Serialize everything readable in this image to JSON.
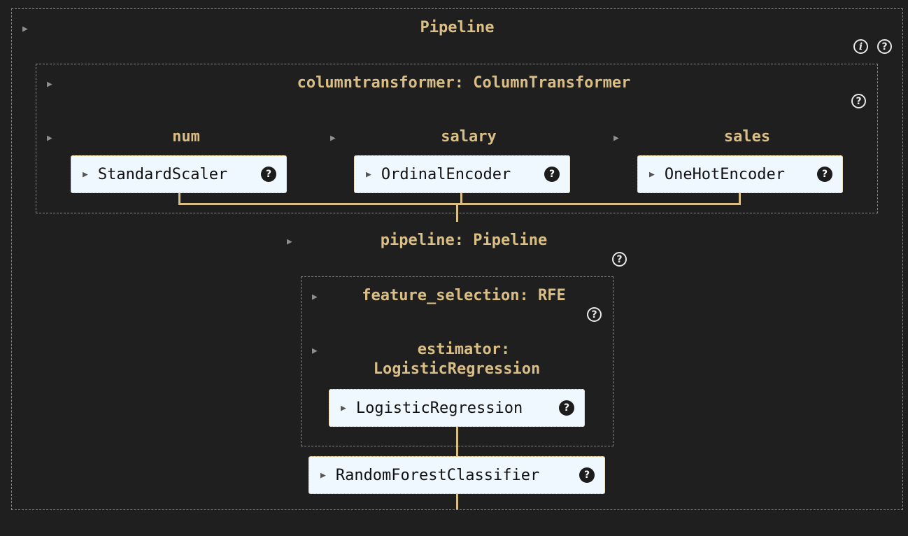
{
  "pipeline": {
    "title": "Pipeline",
    "info_icon_glyph": "i",
    "help_icon_glyph": "?"
  },
  "columntransformer": {
    "title": "columntransformer: ColumnTransformer",
    "help_icon_glyph": "?",
    "branches": [
      {
        "label": "num",
        "estimator": "StandardScaler",
        "help_icon_glyph": "?"
      },
      {
        "label": "salary",
        "estimator": "OrdinalEncoder",
        "help_icon_glyph": "?"
      },
      {
        "label": "sales",
        "estimator": "OneHotEncoder",
        "help_icon_glyph": "?"
      }
    ]
  },
  "inner_pipeline": {
    "title": "pipeline: Pipeline",
    "help_icon_glyph": "?",
    "feature_selection": {
      "title": "feature_selection: RFE",
      "help_icon_glyph": "?",
      "estimator_label_line1": "estimator:",
      "estimator_label_line2": "LogisticRegression",
      "estimator": "LogisticRegression",
      "estimator_help_glyph": "?"
    }
  },
  "final_estimator": {
    "name": "RandomForestClassifier",
    "help_icon_glyph": "?"
  },
  "toggle_glyph": "▶",
  "colors": {
    "background": "#1f1f1f",
    "accent": "#d9bf86",
    "estimator_fill": "#f0f8ff",
    "dashed_border": "#8a8a8a"
  }
}
